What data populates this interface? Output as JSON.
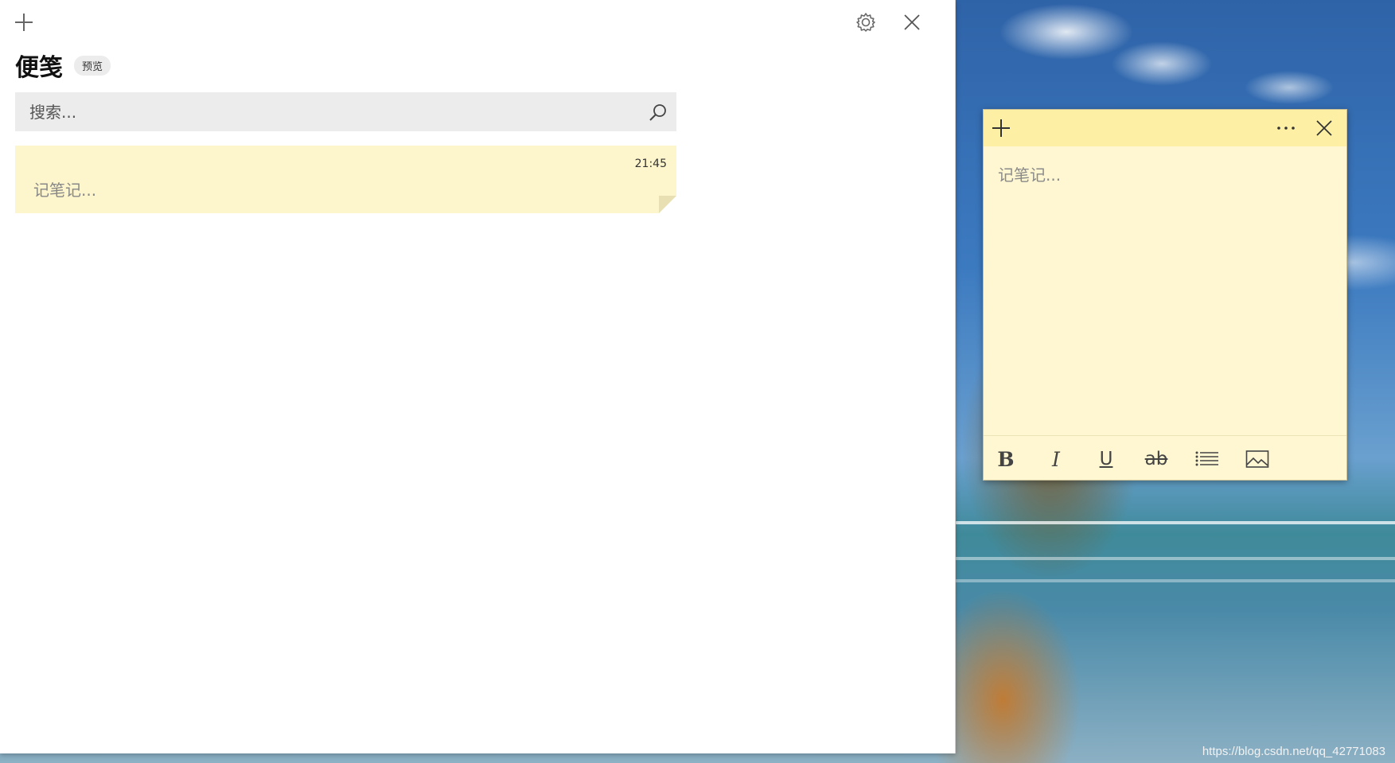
{
  "app": {
    "title": "便笺",
    "badge": "预览"
  },
  "search": {
    "placeholder": "搜索..."
  },
  "notes_list": [
    {
      "time": "21:45",
      "preview": "记笔记..."
    }
  ],
  "note_window": {
    "placeholder": "记笔记...",
    "toolbar": {
      "bold": "B",
      "italic": "I",
      "underline": "U",
      "strikethrough": "ab"
    }
  },
  "icons": {
    "new_note": "plus-icon",
    "settings": "gear-icon",
    "close": "close-icon",
    "search": "search-icon",
    "more": "more-icon",
    "bullets": "bullet-list-icon",
    "image": "image-icon"
  },
  "colors": {
    "note_background": "#fdf5cc",
    "note_header": "#fdefa4",
    "search_background": "#ececec"
  },
  "watermark": "https://blog.csdn.net/qq_42771083"
}
